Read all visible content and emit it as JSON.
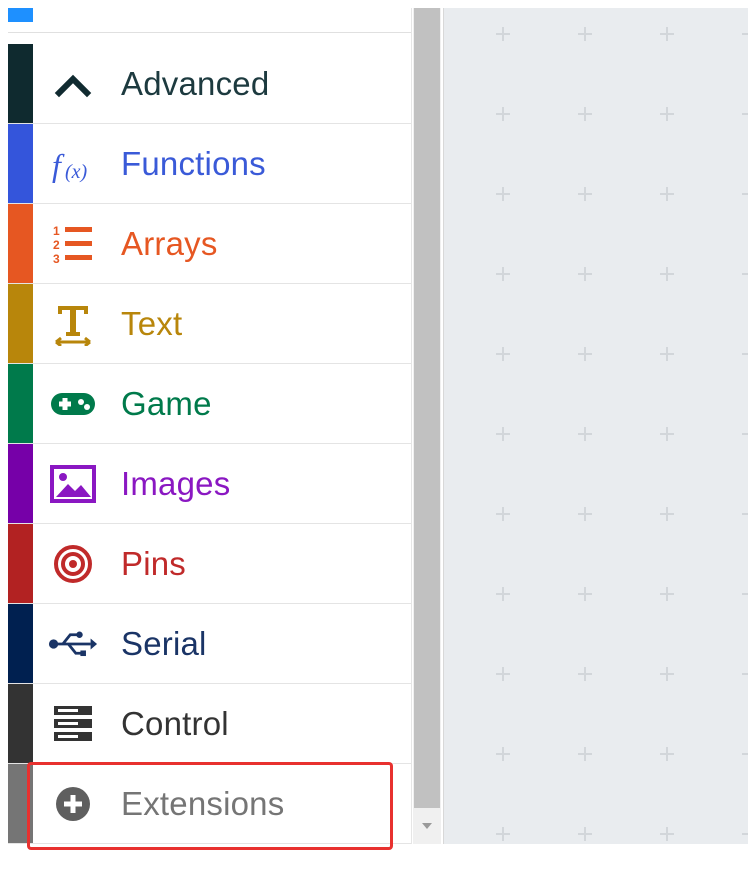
{
  "toolbox": {
    "categories": [
      {
        "id": "advanced",
        "label": "Advanced",
        "color": "#0f2a2f",
        "text_color": "#1d3a3f",
        "icon": "chevron-up-icon"
      },
      {
        "id": "functions",
        "label": "Functions",
        "color": "#3455db",
        "text_color": "#3a5ad8",
        "icon": "function-icon"
      },
      {
        "id": "arrays",
        "label": "Arrays",
        "color": "#e65722",
        "text_color": "#e65722",
        "icon": "numbered-list-icon"
      },
      {
        "id": "text",
        "label": "Text",
        "color": "#b8860b",
        "text_color": "#b8860b",
        "icon": "text-icon"
      },
      {
        "id": "game",
        "label": "Game",
        "color": "#007a4b",
        "text_color": "#007a4b",
        "icon": "gamepad-icon"
      },
      {
        "id": "images",
        "label": "Images",
        "color": "#7600a8",
        "text_color": "#8a17c2",
        "icon": "image-icon"
      },
      {
        "id": "pins",
        "label": "Pins",
        "color": "#b22222",
        "text_color": "#c02a2a",
        "icon": "target-icon"
      },
      {
        "id": "serial",
        "label": "Serial",
        "color": "#002050",
        "text_color": "#1a3466",
        "icon": "usb-icon"
      },
      {
        "id": "control",
        "label": "Control",
        "color": "#333333",
        "text_color": "#333333",
        "icon": "server-stack-icon"
      },
      {
        "id": "extensions",
        "label": "Extensions",
        "color": "#757575",
        "text_color": "#757575",
        "icon": "plus-circle-icon"
      }
    ]
  },
  "highlight": {
    "target": "extensions",
    "color": "#e8312f"
  },
  "colors": {
    "workspace_bg": "#e9ecef",
    "grid_mark": "#d2d6da",
    "scroll_thumb": "#c1c1c1"
  }
}
